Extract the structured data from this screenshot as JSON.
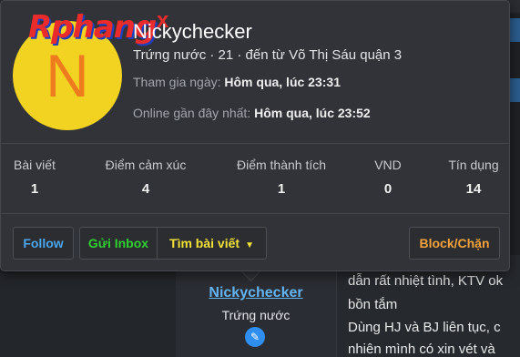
{
  "brand": {
    "logo_text": "Rphang",
    "logo_mark": "x"
  },
  "profile": {
    "avatar_letter": "N",
    "username": "Nickychecker",
    "blurb": "Trứng nước · 21 · đến từ Võ Thị Sáu quận 3",
    "joined_label": "Tham gia ngày:",
    "joined_value": "Hôm qua, lúc 23:31",
    "last_seen_label": "Online gần đây nhất:",
    "last_seen_value": "Hôm qua, lúc 23:52"
  },
  "stats": [
    {
      "label": "Bài viết",
      "value": "1"
    },
    {
      "label": "Điểm cảm xúc",
      "value": "4"
    },
    {
      "label": "Điểm thành tích",
      "value": "1"
    },
    {
      "label": "VND",
      "value": "0"
    },
    {
      "label": "Tín dụng",
      "value": "14"
    }
  ],
  "actions": {
    "follow": "Follow",
    "inbox": "Gửi Inbox",
    "find_posts": "Tìm bài viết",
    "block": "Block/Chặn"
  },
  "background_post": {
    "username": "Nickychecker",
    "user_title": "Trứng nước",
    "lines": [
      "dẫn rất nhiệt tình, KTV ok",
      "bồn tắm",
      "Dùng HJ và BJ liên tục, c",
      "nhiên mình có xin vét và"
    ]
  },
  "colors": {
    "accent_blue": "#4aa6ef",
    "inbox_green": "#2fd12f",
    "find_yellow": "#f3e337",
    "block_orange": "#f5a23c",
    "avatar_bg": "#f2d321",
    "avatar_fg": "#ef7b1f"
  }
}
